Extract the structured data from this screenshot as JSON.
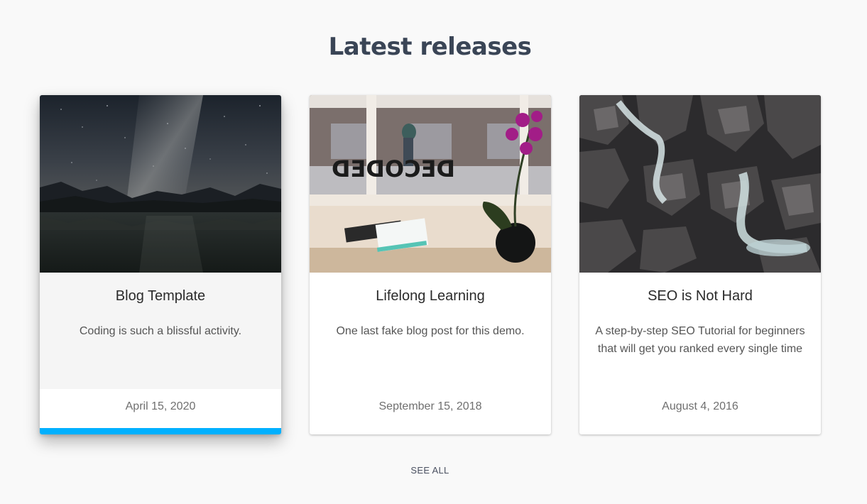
{
  "section": {
    "title": "Latest releases",
    "see_all_label": "SEE ALL"
  },
  "cards": [
    {
      "title": "Blog Template",
      "description": "Coding is such a blissful activity.",
      "date": "April 15, 2020",
      "image": "night-sky-mountain-lake",
      "active": true
    },
    {
      "title": "Lifelong Learning",
      "description": "One last fake blog post for this demo.",
      "date": "September 15, 2018",
      "image": "window-orchid-decoded",
      "active": false
    },
    {
      "title": "SEO is Not Hard",
      "description": "A step-by-step SEO Tutorial for beginners that will get you ranked every single time",
      "date": "August 4, 2016",
      "image": "rocky-waterfall",
      "active": false
    }
  ],
  "colors": {
    "accent_bar": "#00b0ff",
    "title": "#3a4556",
    "background": "#f9f9f9"
  }
}
